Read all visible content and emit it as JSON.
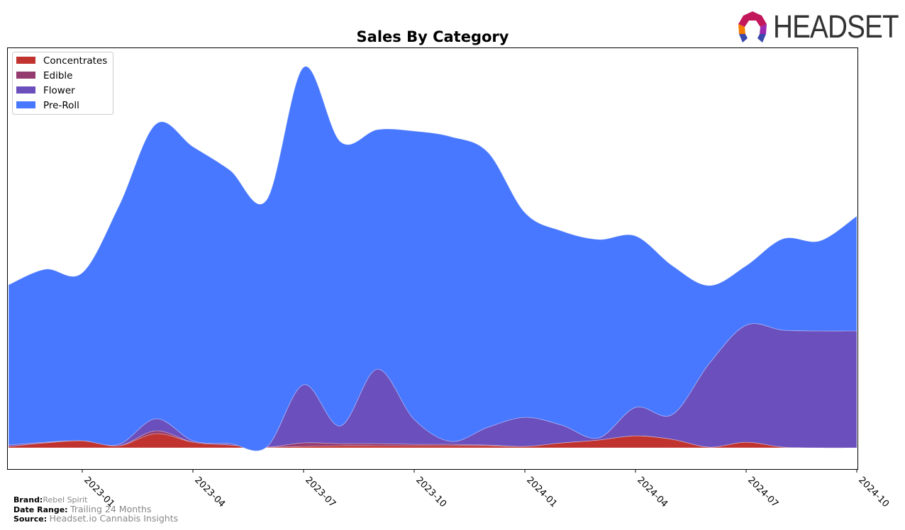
{
  "logo": {
    "text": "HEADSET"
  },
  "footer": {
    "brand_label": "Brand:",
    "brand_value": "Rebel Spirit",
    "date_label": "Date Range:",
    "date_value": "Trailing 24 Months",
    "source_label": "Source:",
    "source_value": "Headset.io Cannabis Insights"
  },
  "chart_data": {
    "type": "area",
    "stacked": true,
    "title": "Sales By Category",
    "xlabel": "",
    "ylabel": "",
    "y_ticks_visible": false,
    "grid": false,
    "legend_position": "top-left",
    "x": [
      "2022-11",
      "2022-12",
      "2023-01",
      "2023-02",
      "2023-03",
      "2023-04",
      "2023-05",
      "2023-06",
      "2023-07",
      "2023-08",
      "2023-09",
      "2023-10",
      "2023-11",
      "2023-12",
      "2024-01",
      "2024-02",
      "2024-03",
      "2024-04",
      "2024-05",
      "2024-06",
      "2024-07",
      "2024-08",
      "2024-09",
      "2024-10"
    ],
    "x_tick_labels": [
      "2023-01",
      "2023-04",
      "2023-07",
      "2023-10",
      "2024-01",
      "2024-04",
      "2024-07",
      "2024-10"
    ],
    "x_tick_indices": [
      2,
      5,
      8,
      11,
      14,
      17,
      20,
      23
    ],
    "series": [
      {
        "name": "Concentrates",
        "color": "#c0332f",
        "values": [
          2,
          7,
          10,
          3,
          20,
          8,
          4,
          1,
          2,
          3,
          3,
          3,
          3,
          3,
          2,
          7,
          11,
          17,
          12,
          1,
          8,
          1,
          0,
          0
        ]
      },
      {
        "name": "Edible",
        "color": "#943b70",
        "values": [
          0,
          0,
          0,
          0,
          4,
          0,
          0,
          0,
          5,
          3,
          3,
          2,
          2,
          1,
          0,
          0,
          0,
          0,
          0,
          0,
          0,
          0,
          0,
          0
        ]
      },
      {
        "name": "Flower",
        "color": "#6a4fbd",
        "values": [
          2,
          1,
          0,
          2,
          17,
          2,
          2,
          0,
          82,
          25,
          105,
          35,
          4,
          25,
          41,
          25,
          3,
          40,
          35,
          118,
          165,
          165,
          165,
          165
        ]
      },
      {
        "name": "Pre-Roll",
        "color": "#4878ff",
        "values": [
          226,
          244,
          237,
          337,
          416,
          415,
          386,
          349,
          448,
          401,
          338,
          407,
          430,
          388,
          289,
          274,
          280,
          242,
          210,
          110,
          84,
          129,
          127,
          162
        ]
      }
    ],
    "ylim": [
      -30,
      565
    ]
  }
}
